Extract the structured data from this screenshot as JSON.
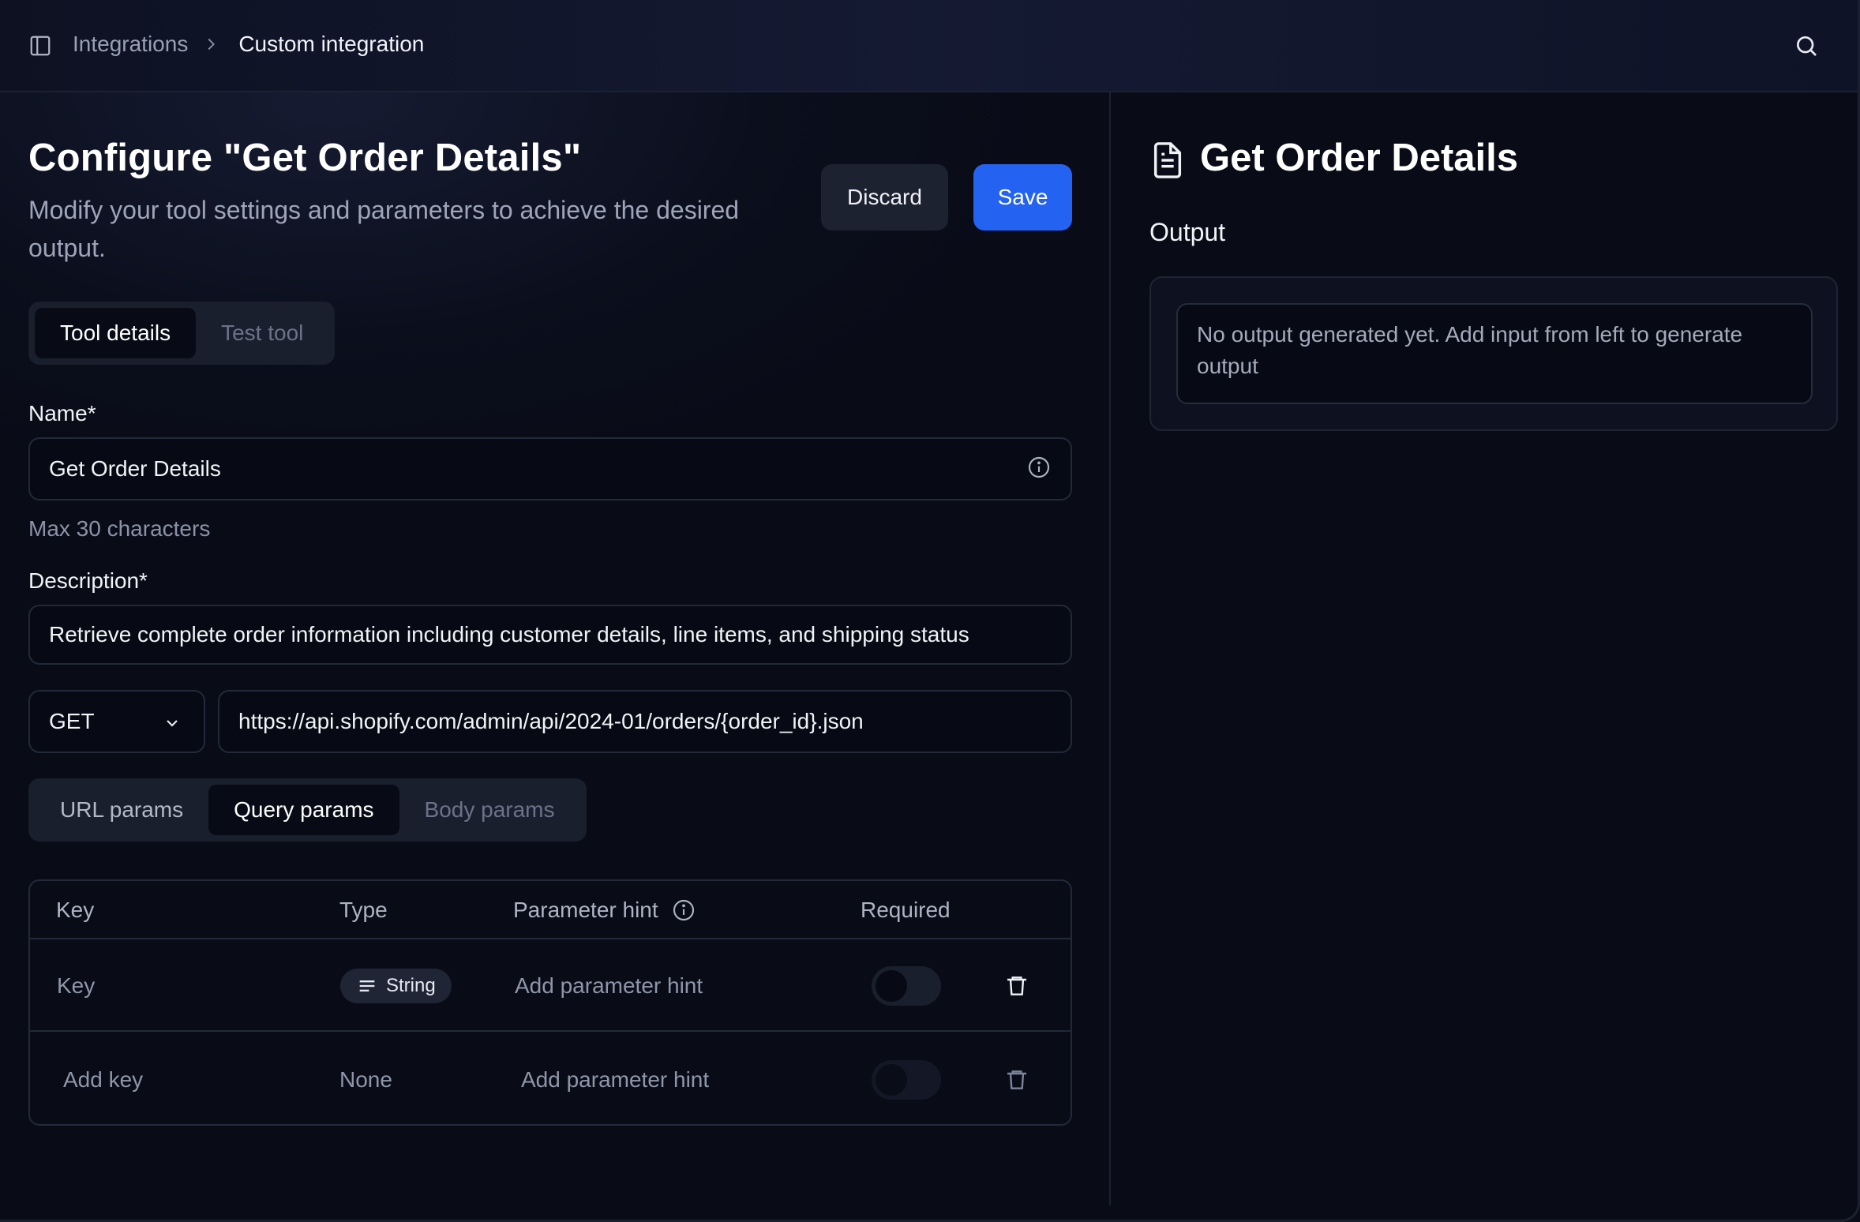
{
  "header": {
    "breadcrumb": {
      "parent": "Integrations",
      "current": "Custom integration"
    }
  },
  "page": {
    "title": "Configure \"Get Order Details\"",
    "subtitle": "Modify your tool settings and parameters to achieve the desired output.",
    "discard_label": "Discard",
    "save_label": "Save"
  },
  "tool_tabs": [
    {
      "label": "Tool details",
      "active": true
    },
    {
      "label": "Test tool",
      "active": false
    }
  ],
  "form": {
    "name_label": "Name*",
    "name_value": "Get Order Details",
    "name_helper": "Max 30 characters",
    "description_label": "Description*",
    "description_value": "Retrieve complete order information including customer details, line items, and shipping status",
    "method": "GET",
    "url": "https://api.shopify.com/admin/api/2024-01/orders/{order_id}.json"
  },
  "param_tabs": [
    {
      "label": "URL params",
      "active": false
    },
    {
      "label": "Query params",
      "active": true
    },
    {
      "label": "Body params",
      "active": false
    }
  ],
  "params_table": {
    "columns": [
      "Key",
      "Type",
      "Parameter hint",
      "Required"
    ],
    "rows": [
      {
        "key": "Key",
        "type": "String",
        "hint": "Add parameter hint",
        "required": false
      },
      {
        "key": "Add key",
        "type": "None",
        "hint": "Add parameter hint",
        "required": false
      }
    ]
  },
  "output_panel": {
    "title": "Get Order Details",
    "label": "Output",
    "empty_message": "No output generated yet. Add input from left to generate output"
  },
  "colors": {
    "accent": "#2463f2",
    "background": "#0b0f1d"
  }
}
